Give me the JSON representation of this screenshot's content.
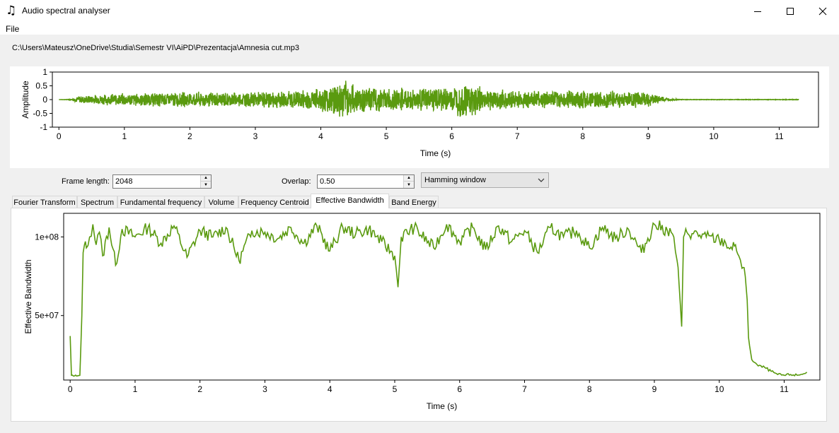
{
  "window": {
    "title": "Audio spectral analyser",
    "icon": "music-note-icon",
    "controls": [
      "minimize-icon",
      "maximize-icon",
      "close-icon"
    ]
  },
  "menu": {
    "file": "File"
  },
  "file_path": "C:\\Users\\Mateusz\\OneDrive\\Studia\\Semestr VI\\AiPD\\Prezentacja\\Amnesia cut.mp3",
  "controls": {
    "frame_length_label": "Frame length:",
    "frame_length": "2048",
    "overlap_label": "Overlap:",
    "overlap": "0.50",
    "window_type": "Hamming window"
  },
  "tabs": [
    "Fourier Transform",
    "Spectrum",
    "Fundamental frequency",
    "Volume",
    "Frequency Centroid",
    "Effective Bandwidth",
    "Band Energy"
  ],
  "active_tab": "Effective Bandwidth",
  "colors": {
    "line": "#5a9a0f",
    "window_bg": "#f0f0f0",
    "panel_bg": "#ffffff"
  },
  "chart_data": [
    {
      "type": "line",
      "ylabel": "Amplitude",
      "xlabel": "Time (s)",
      "xlim": [
        -0.1,
        11.6
      ],
      "ylim": [
        -1,
        1
      ],
      "xticks": [
        "0",
        "1",
        "2",
        "3",
        "4",
        "5",
        "6",
        "7",
        "8",
        "9",
        "10",
        "11"
      ],
      "yticks": [
        "1",
        "0.5",
        "0",
        "-0.5",
        "-1"
      ],
      "series": [
        {
          "values": {
            "t": [
              0,
              0.2,
              0.3,
              1.0,
              2.0,
              3.0,
              3.5,
              4.0,
              4.3,
              4.6,
              5.0,
              5.5,
              6.0,
              6.2,
              6.5,
              7.0,
              8.0,
              8.5,
              9.0,
              9.3,
              9.5,
              10.0,
              11.0,
              11.3
            ],
            "envelope": [
              0,
              0.02,
              0.15,
              0.25,
              0.3,
              0.3,
              0.35,
              0.45,
              0.8,
              0.5,
              0.45,
              0.45,
              0.5,
              0.75,
              0.45,
              0.35,
              0.35,
              0.35,
              0.3,
              0.05,
              0.01,
              0.01,
              0.01,
              0.01
            ]
          }
        }
      ]
    },
    {
      "type": "line",
      "ylabel": "Effective Bandwidth",
      "xlabel": "Time (s)",
      "xlim": [
        -0.1,
        11.55
      ],
      "ylim": [
        9000000,
        115000000
      ],
      "xticks": [
        "0",
        "1",
        "2",
        "3",
        "4",
        "5",
        "6",
        "7",
        "8",
        "9",
        "10",
        "11"
      ],
      "yticks": [
        "1e+08",
        "5e+07"
      ],
      "series": [
        {
          "values": {
            "x": [
              0,
              0.02,
              0.05,
              0.1,
              0.15,
              0.18,
              0.2,
              0.22,
              0.25,
              0.3,
              0.35,
              0.4,
              0.45,
              0.5,
              0.6,
              0.7,
              0.8,
              1.0,
              1.2,
              1.4,
              1.6,
              1.8,
              2.0,
              2.2,
              2.4,
              2.6,
              2.8,
              3.0,
              3.2,
              3.4,
              3.6,
              3.8,
              4.0,
              4.2,
              4.4,
              4.6,
              4.8,
              5.0,
              5.05,
              5.1,
              5.3,
              5.6,
              5.8,
              6.0,
              6.2,
              6.4,
              6.6,
              6.8,
              7.0,
              7.2,
              7.4,
              7.6,
              7.8,
              8.0,
              8.2,
              8.4,
              8.6,
              8.8,
              9.0,
              9.2,
              9.3,
              9.35,
              9.38,
              9.42,
              9.45,
              9.5,
              9.6,
              9.8,
              10.0,
              10.1,
              10.2,
              10.25,
              10.3,
              10.35,
              10.4,
              10.43,
              10.45,
              10.5,
              10.6,
              10.7,
              10.8,
              10.9,
              11.0,
              11.1,
              11.2,
              11.3,
              11.35
            ],
            "y": [
              37000000,
              12000000,
              11500000,
              11500000,
              12000000,
              50000000,
              90000000,
              95000000,
              93000000,
              100000000,
              108000000,
              95000000,
              103000000,
              88000000,
              106000000,
              82000000,
              105000000,
              100000000,
              106000000,
              96000000,
              107000000,
              87000000,
              104000000,
              100000000,
              106000000,
              85000000,
              104000000,
              103000000,
              99000000,
              106000000,
              96000000,
              107000000,
              91000000,
              106000000,
              102000000,
              105000000,
              97000000,
              88000000,
              68000000,
              100000000,
              106000000,
              93000000,
              108000000,
              97000000,
              106000000,
              92000000,
              107000000,
              97000000,
              104000000,
              90000000,
              106000000,
              100000000,
              104000000,
              93000000,
              106000000,
              99000000,
              105000000,
              90000000,
              108000000,
              104000000,
              100000000,
              85000000,
              70000000,
              43000000,
              100000000,
              103000000,
              102000000,
              100000000,
              98000000,
              96000000,
              92000000,
              95000000,
              88000000,
              80000000,
              75000000,
              60000000,
              36000000,
              22000000,
              18000000,
              17000000,
              14500000,
              12500000,
              12000000,
              12500000,
              12000000,
              13000000,
              14000000
            ]
          }
        }
      ]
    }
  ]
}
